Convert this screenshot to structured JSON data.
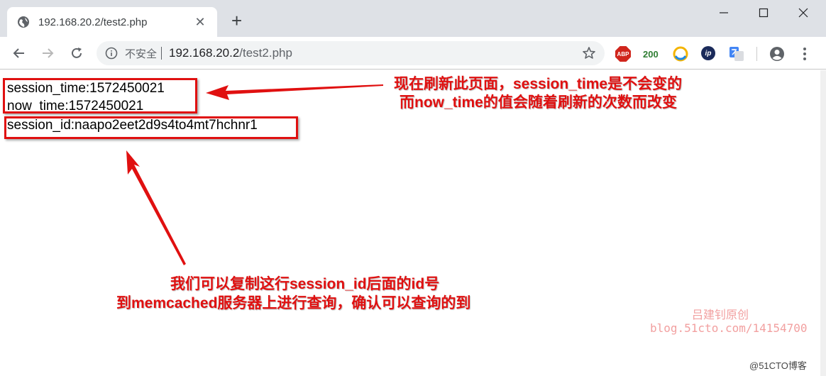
{
  "browser": {
    "tab": {
      "title": "192.168.20.2/test2.php",
      "close": "✕"
    },
    "new_tab": "+",
    "toolbar": {
      "insecure_label": "不安全",
      "url_host": "192.168.20.2",
      "url_path": "/test2.php"
    },
    "extensions": {
      "abp": "ABP",
      "counter": "200",
      "ip": "ip"
    }
  },
  "page": {
    "session_time": "session_time:1572450021",
    "now_time": "now_time:1572450021",
    "session_id": "session_id:naapo2eet2d9s4to4mt7hchnr1"
  },
  "annotations": {
    "top_line1": "现在刷新此页面，session_time是不会变的",
    "top_line2": "而now_time的值会随着刷新的次数而改变",
    "bottom_line1": "我们可以复制这行session_id后面的id号",
    "bottom_line2": "到memcached服务器上进行查询，确认可以查询的到"
  },
  "watermark": {
    "author": "吕建钊原创",
    "blog": "blog.51cto.com/14154700",
    "site": "@51CTO博客"
  },
  "colors": {
    "annotation_red": "#e01010",
    "tabstrip": "#dee1e6",
    "omnibox": "#f1f3f4"
  }
}
